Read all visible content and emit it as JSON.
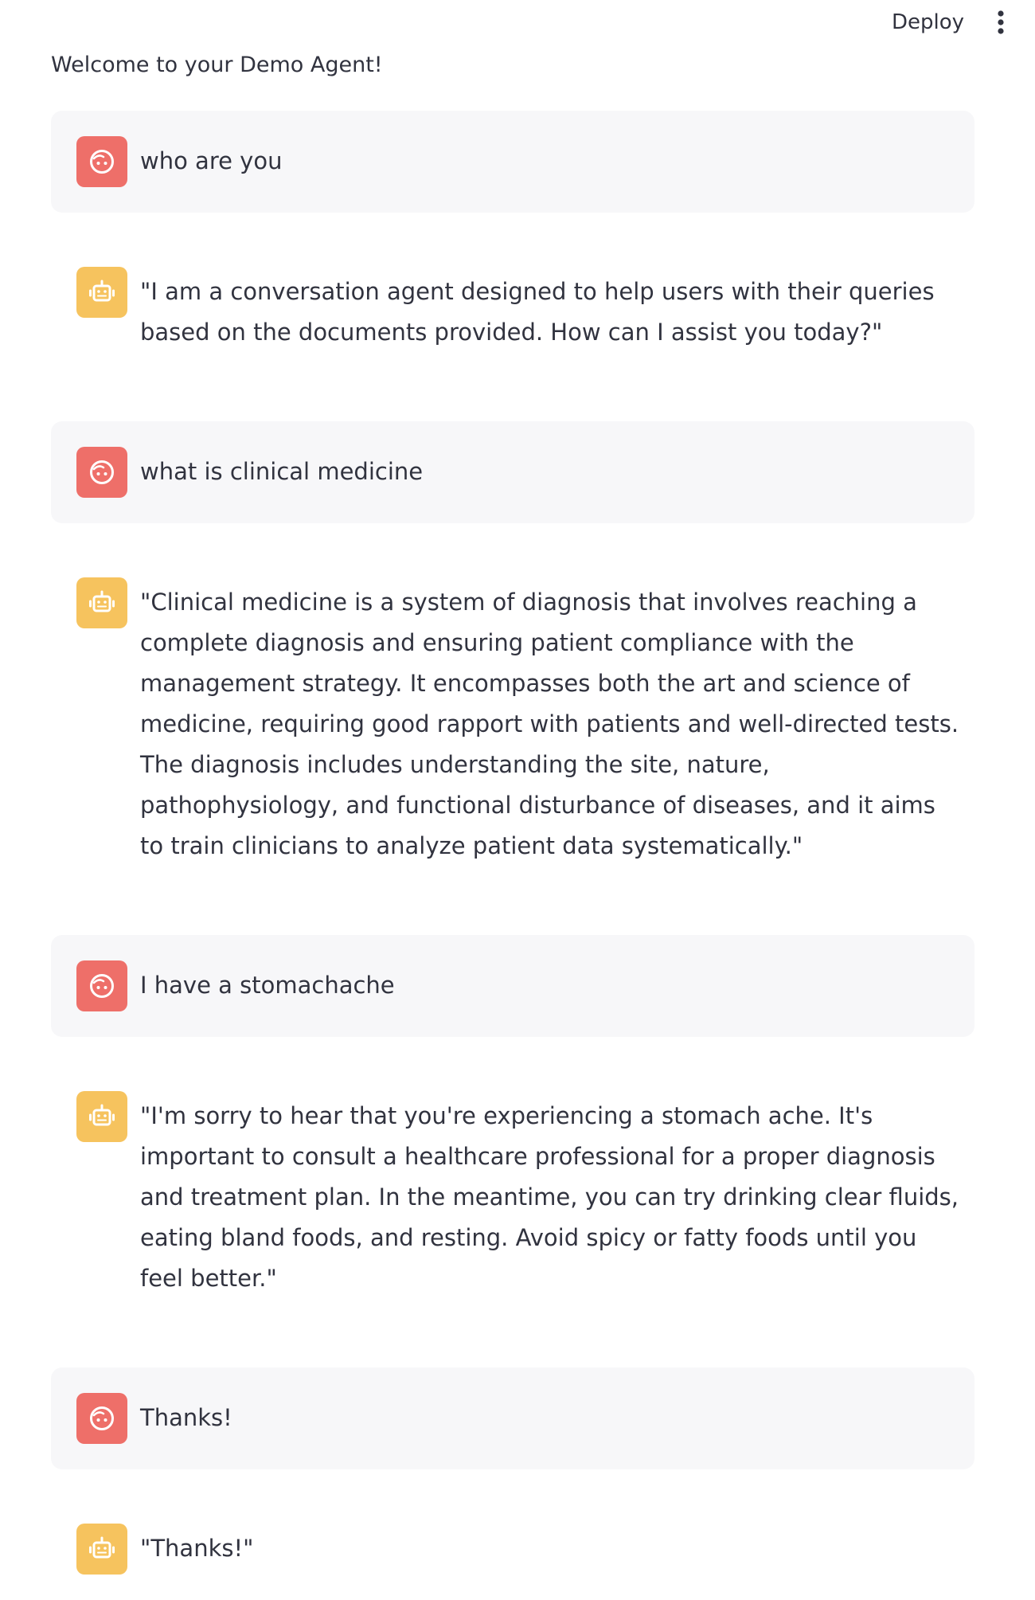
{
  "header": {
    "deploy_label": "Deploy",
    "menu_icon": "more-vertical-icon"
  },
  "welcome": "Welcome to your Demo Agent!",
  "colors": {
    "user_avatar": "#ee6f69",
    "assistant_avatar": "#f6c35e",
    "user_bubble": "#f7f7f9",
    "text": "#31333f"
  },
  "messages": [
    {
      "role": "user",
      "icon": "user-face-icon",
      "text": "who are you"
    },
    {
      "role": "assistant",
      "icon": "robot-icon",
      "text": "\"I am a conversation agent designed to help users with their queries based on the documents provided. How can I assist you today?\""
    },
    {
      "role": "user",
      "icon": "user-face-icon",
      "text": "what is clinical medicine"
    },
    {
      "role": "assistant",
      "icon": "robot-icon",
      "text": "\"Clinical medicine is a system of diagnosis that involves reaching a complete diagnosis and ensuring patient compliance with the management strategy. It encompasses both the art and science of medicine, requiring good rapport with patients and well-directed tests. The diagnosis includes understanding the site, nature, pathophysiology, and functional disturbance of diseases, and it aims to train clinicians to analyze patient data systematically.\""
    },
    {
      "role": "user",
      "icon": "user-face-icon",
      "text": "I have a stomachache"
    },
    {
      "role": "assistant",
      "icon": "robot-icon",
      "text": "\"I'm sorry to hear that you're experiencing a stomach ache. It's important to consult a healthcare professional for a proper diagnosis and treatment plan. In the meantime, you can try drinking clear fluids, eating bland foods, and resting. Avoid spicy or fatty foods until you feel better.\""
    },
    {
      "role": "user",
      "icon": "user-face-icon",
      "text": "Thanks!"
    },
    {
      "role": "assistant",
      "icon": "robot-icon",
      "text": "\"Thanks!\""
    }
  ]
}
